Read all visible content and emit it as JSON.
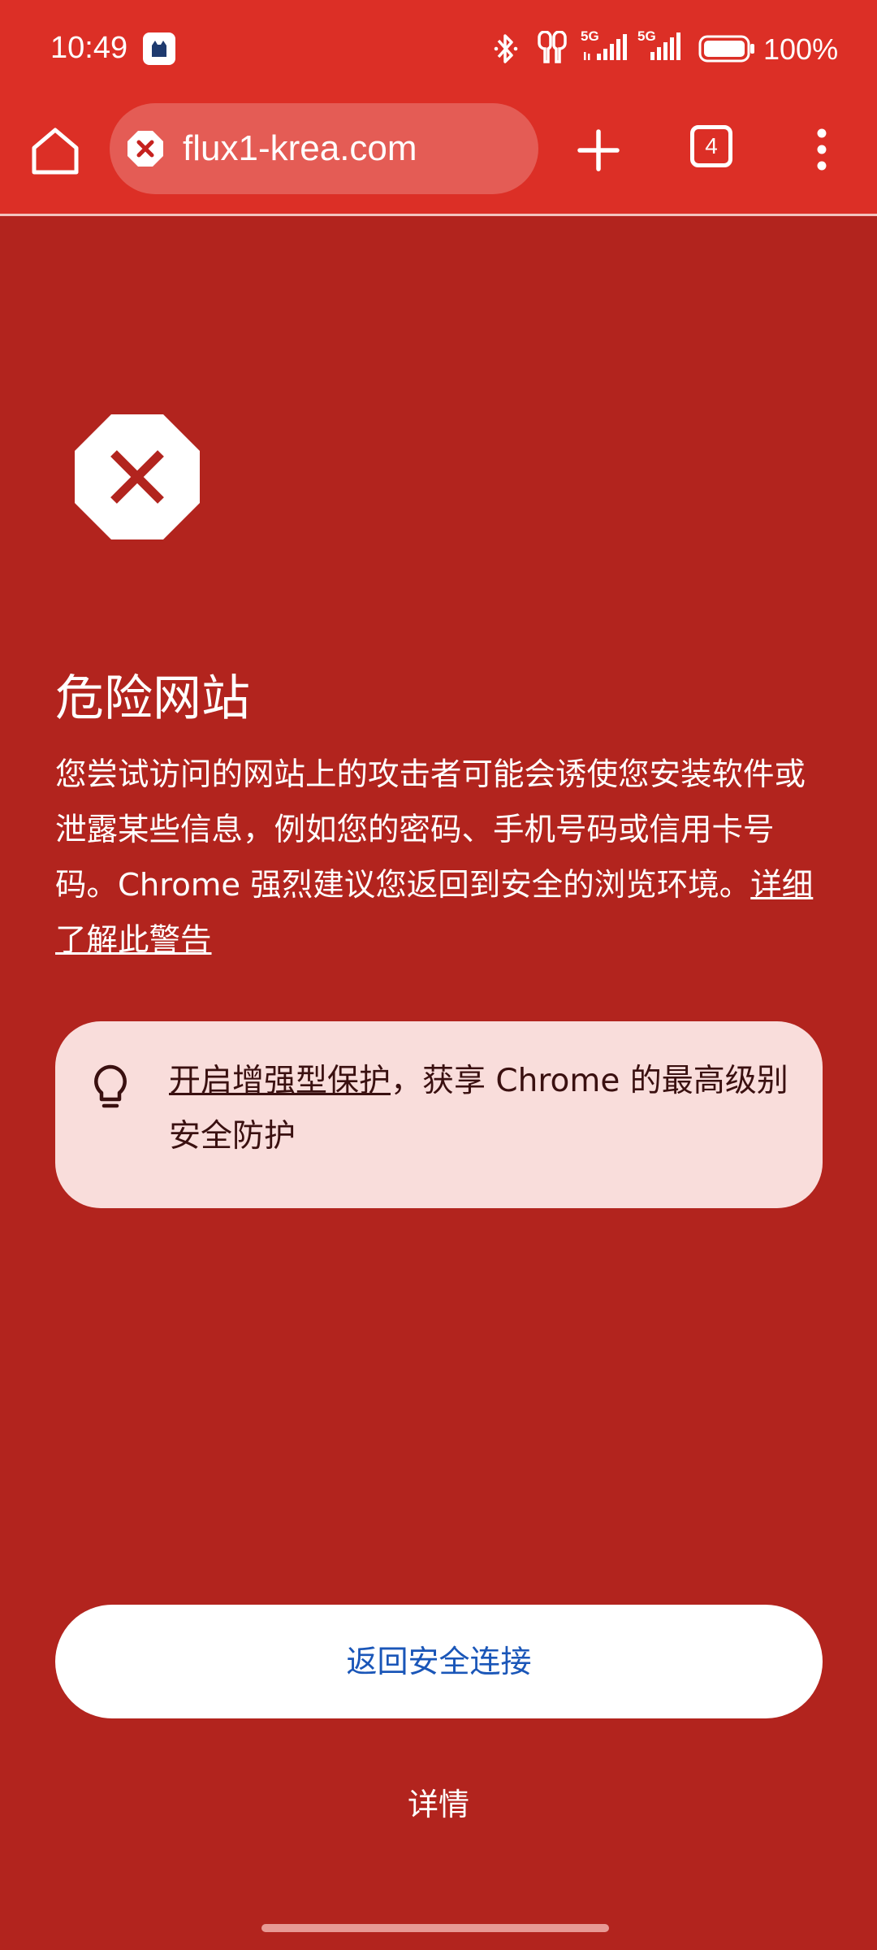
{
  "status_bar": {
    "time": "10:49",
    "battery_percent": "100%",
    "network_labels": [
      "5G",
      "5G"
    ],
    "icons": [
      "app-notification-icon",
      "bluetooth-icon",
      "earbuds-icon",
      "signal-icon",
      "signal-icon",
      "battery-icon"
    ]
  },
  "toolbar": {
    "url": "flux1-krea.com",
    "tab_count": "4",
    "icons": [
      "home-icon",
      "dangerous-site-icon",
      "plus-icon",
      "tab-switcher-icon",
      "more-vert-icon"
    ]
  },
  "warning": {
    "icon": "stop-octagon-x-icon",
    "title": "危险网站",
    "body": "您尝试访问的网站上的攻击者可能会诱使您安装软件或泄露某些信息，例如您的密码、手机号码或信用卡号码。Chrome 强烈建议您返回到安全的浏览环境。",
    "learn_more_link": "详细了解此警告"
  },
  "tip": {
    "icon": "lightbulb-icon",
    "link_text": "开启增强型保护",
    "rest_text": "，获享 Chrome 的最高级别安全防护"
  },
  "actions": {
    "primary_label": "返回安全连接",
    "details_label": "详情"
  },
  "colors": {
    "page_background": "#b2241e",
    "toolbar_background": "#dc2f26",
    "omnibox_background": "#e45c55",
    "tip_background": "#f9dddb",
    "primary_button_text": "#1a56b8"
  }
}
